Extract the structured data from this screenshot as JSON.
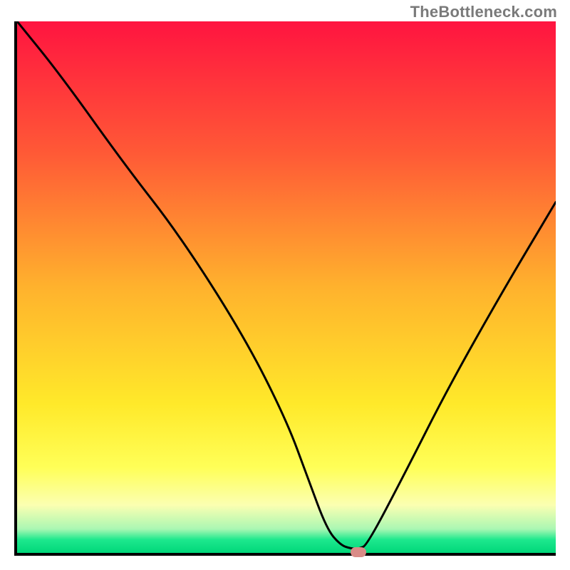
{
  "watermark": "TheBottleneck.com",
  "chart_data": {
    "type": "line",
    "title": "",
    "xlabel": "",
    "ylabel": "",
    "xlim": [
      0,
      100
    ],
    "ylim": [
      0,
      100
    ],
    "grid": false,
    "axes_visible": {
      "left": true,
      "bottom": true,
      "right": false,
      "top": false
    },
    "tick_labels": false,
    "background_gradient": {
      "direction": "vertical",
      "stops": [
        {
          "pos": 0.0,
          "color": "#ff1440"
        },
        {
          "pos": 0.25,
          "color": "#ff5a36"
        },
        {
          "pos": 0.5,
          "color": "#ffb22d"
        },
        {
          "pos": 0.72,
          "color": "#ffe92a"
        },
        {
          "pos": 0.84,
          "color": "#ffff58"
        },
        {
          "pos": 0.91,
          "color": "#fbffb1"
        },
        {
          "pos": 0.955,
          "color": "#aaf7b3"
        },
        {
          "pos": 0.975,
          "color": "#1ee88d"
        },
        {
          "pos": 1.0,
          "color": "#00d77a"
        }
      ]
    },
    "series": [
      {
        "name": "bottleneck-curve",
        "color": "#000000",
        "x": [
          0,
          8,
          20,
          30,
          42,
          50,
          54,
          57.5,
          60,
          62,
          63.5,
          65,
          72,
          80,
          90,
          100
        ],
        "y": [
          100,
          90,
          73,
          60,
          41,
          25,
          14,
          4.5,
          1.5,
          0.8,
          0.8,
          1.5,
          15,
          31,
          49,
          66
        ]
      }
    ],
    "marker": {
      "name": "optimal-point",
      "x": 63,
      "y": 0.7,
      "color": "#d98b87",
      "shape": "rounded-pill"
    }
  },
  "colors": {
    "axis": "#000000",
    "watermark": "#7a7a7a"
  }
}
